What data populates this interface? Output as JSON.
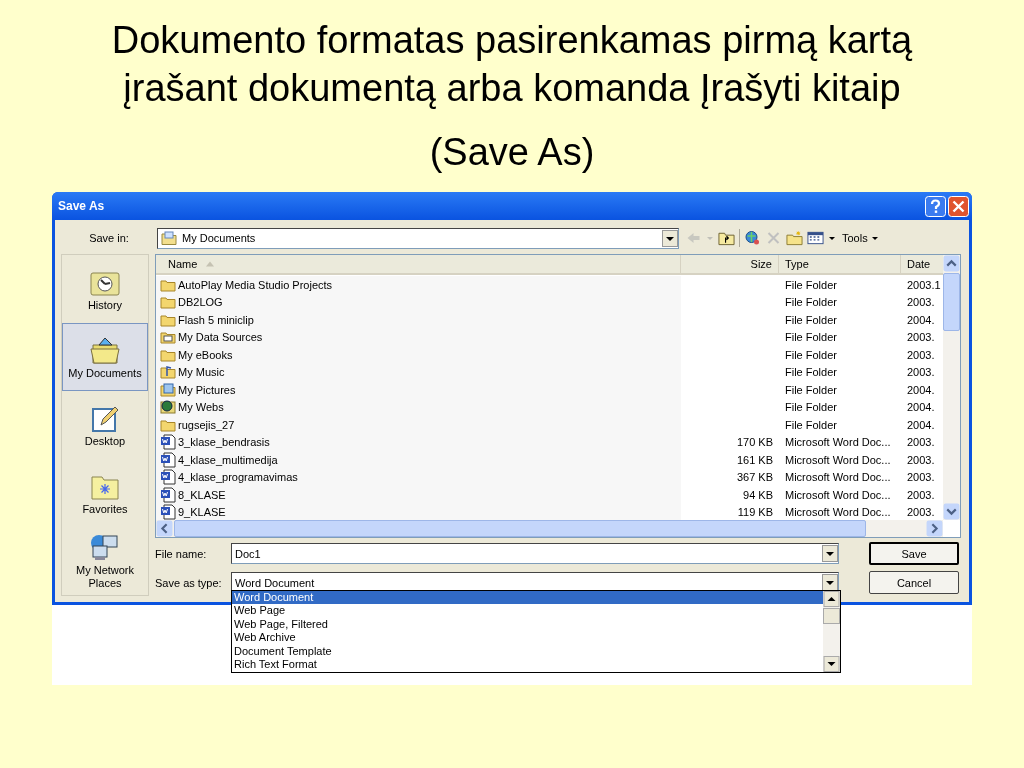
{
  "slide": {
    "title": "Dokumento formatas pasirenkamas pirmą kartą įrašant dokumentą arba komanda Įrašyti kitaip",
    "subtitle": "(Save As)"
  },
  "dialog": {
    "title": "Save As",
    "save_in": {
      "label": "Save in:",
      "value": "My Documents"
    },
    "toolbar": {
      "tools": "Tools"
    },
    "places": [
      {
        "label": "History",
        "kind": "history",
        "selected": false
      },
      {
        "label": "My Documents",
        "kind": "documents",
        "selected": true
      },
      {
        "label": "Desktop",
        "kind": "desktop",
        "selected": false
      },
      {
        "label": "Favorites",
        "kind": "favorites",
        "selected": false
      },
      {
        "label": "My Network Places",
        "kind": "network",
        "selected": false
      }
    ],
    "columns": [
      "Name",
      "Size",
      "Type",
      "Date"
    ],
    "files": [
      {
        "name": "AutoPlay Media Studio Projects",
        "type": "File Folder",
        "date": "2003.1",
        "kind": "folder"
      },
      {
        "name": "DB2LOG",
        "type": "File Folder",
        "date": "2003.",
        "kind": "folder"
      },
      {
        "name": "Flash 5 miniclip",
        "type": "File Folder",
        "date": "2004.",
        "kind": "folder"
      },
      {
        "name": "My Data Sources",
        "type": "File Folder",
        "date": "2003.",
        "kind": "data"
      },
      {
        "name": "My eBooks",
        "type": "File Folder",
        "date": "2003.",
        "kind": "folder"
      },
      {
        "name": "My Music",
        "type": "File Folder",
        "date": "2003.",
        "kind": "music"
      },
      {
        "name": "My Pictures",
        "type": "File Folder",
        "date": "2004.",
        "kind": "pictures"
      },
      {
        "name": "My Webs",
        "type": "File Folder",
        "date": "2004.",
        "kind": "webs"
      },
      {
        "name": "rugsejis_27",
        "type": "File Folder",
        "date": "2004.",
        "kind": "folder"
      },
      {
        "name": "3_klase_bendrasis",
        "size": "170 KB",
        "type": "Microsoft Word Doc...",
        "date": "2003.",
        "kind": "word"
      },
      {
        "name": "4_klase_multimedija",
        "size": "161 KB",
        "type": "Microsoft Word Doc...",
        "date": "2003.",
        "kind": "word"
      },
      {
        "name": "4_klase_programavimas",
        "size": "367 KB",
        "type": "Microsoft Word Doc...",
        "date": "2003.",
        "kind": "word"
      },
      {
        "name": "8_KLASE",
        "size": "94 KB",
        "type": "Microsoft Word Doc...",
        "date": "2003.",
        "kind": "word"
      },
      {
        "name": "9_KLASE",
        "size": "119 KB",
        "type": "Microsoft Word Doc...",
        "date": "2003.",
        "kind": "word"
      }
    ],
    "file_name": {
      "label": "File name:",
      "value": "Doc1"
    },
    "save_as_type": {
      "label": "Save as type:",
      "value": "Word Document",
      "expanded": true,
      "options": [
        {
          "label": "Word Document",
          "selected": true
        },
        {
          "label": "Web Page",
          "selected": false
        },
        {
          "label": "Web Page, Filtered",
          "selected": false
        },
        {
          "label": "Web Archive",
          "selected": false
        },
        {
          "label": "Document Template",
          "selected": false
        },
        {
          "label": "Rich Text Format",
          "selected": false
        }
      ]
    },
    "buttons": [
      {
        "label": "Save",
        "default": true
      },
      {
        "label": "Cancel",
        "default": false
      }
    ]
  }
}
